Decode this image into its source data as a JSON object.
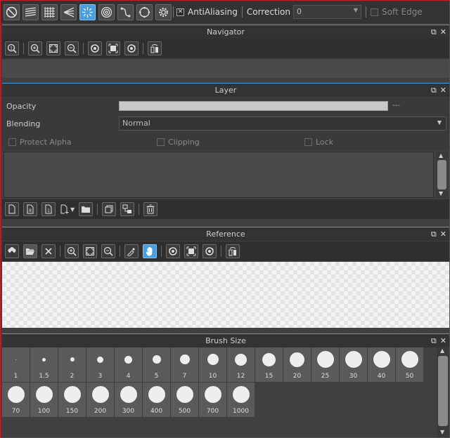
{
  "toolbar": {
    "tools": [
      "no-symmetry-icon",
      "parallel-lines-icon",
      "grid-icon",
      "perspective-icon",
      "radial-lines-icon",
      "concentric-circles-icon",
      "curve-icon",
      "circle-icon",
      "settings-icon"
    ],
    "active_tool": 4,
    "antialiasing_label": "AntiAliasing",
    "antialiasing_checked": "✕",
    "correction_label": "Correction",
    "correction_value": "0",
    "soft_edge_label": "Soft Edge"
  },
  "navigator": {
    "title": "Navigator",
    "tools": [
      "actual-size-icon",
      "zoom-in-icon",
      "fit-icon",
      "zoom-out-icon",
      "rotate-left-icon",
      "reset-rotation-icon",
      "rotate-right-icon",
      "flip-icon"
    ]
  },
  "layer": {
    "title": "Layer",
    "opacity_label": "Opacity",
    "opacity_value": "---",
    "blending_label": "Blending",
    "blending_value": "Normal",
    "protect_alpha_label": "Protect Alpha",
    "clipping_label": "Clipping",
    "lock_label": "Lock",
    "tools": [
      "new-layer-icon",
      "new-8bit-layer-icon",
      "new-1bit-layer-icon",
      "add-layer-menu-icon",
      "folder-icon",
      "duplicate-icon",
      "merge-icon",
      "delete-icon"
    ]
  },
  "reference": {
    "title": "Reference",
    "tools": [
      "load-image-icon",
      "open-folder-icon",
      "close-icon",
      "zoom-in-icon",
      "fit-icon",
      "zoom-out-icon",
      "eyedropper-icon",
      "hand-icon",
      "rotate-left-icon",
      "reset-rotation-icon",
      "rotate-right-icon",
      "flip-icon"
    ],
    "active_tool": 7
  },
  "brush_size": {
    "title": "Brush Size",
    "sizes": [
      "1",
      "1.5",
      "2",
      "3",
      "4",
      "5",
      "7",
      "10",
      "12",
      "15",
      "20",
      "25",
      "30",
      "40",
      "50",
      "70",
      "100",
      "150",
      "200",
      "300",
      "400",
      "500",
      "700",
      "1000"
    ]
  },
  "colors": {
    "accent": "#4a9ede",
    "panel_bg": "#404040",
    "header_bg": "#333333",
    "border": "#c0202a"
  }
}
